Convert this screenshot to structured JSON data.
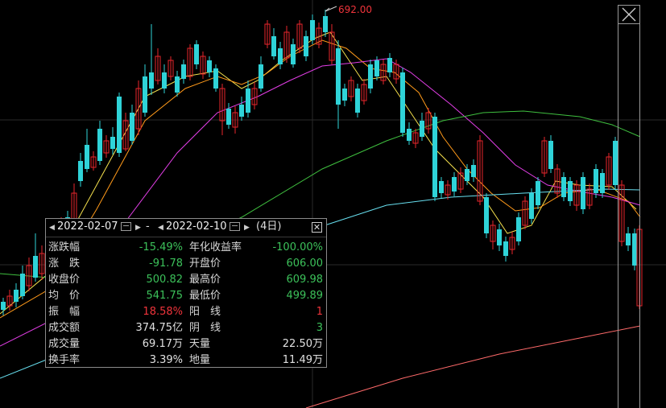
{
  "chart": {
    "high_marker": "692.00",
    "colors": {
      "up": "#e8262c",
      "down": "#2fd3d8",
      "ma5": "#ffffff",
      "ma10": "#f4e04d",
      "ma20": "#ff9a1a",
      "ma30": "#e23ee6",
      "ma60": "#3fbf3f",
      "ma120": "#68e0f0",
      "ma250": "#ff6a6a"
    }
  },
  "range_panel": {
    "start_date": "2022-02-07",
    "separator": "-",
    "end_date": "2022-02-10",
    "days": "(4日)",
    "rows": [
      {
        "label": "涨跌幅",
        "value": "-15.49%",
        "value_color": "g",
        "label2": "年化收益率",
        "value2": "-100.00%",
        "value2_color": "g"
      },
      {
        "label": "涨　跌",
        "value": "-91.78",
        "value_color": "g",
        "label2": "开盘价",
        "value2": "606.00",
        "value2_color": "g"
      },
      {
        "label": "收盘价",
        "value": "500.82",
        "value_color": "g",
        "label2": "最高价",
        "value2": "609.98",
        "value2_color": "g"
      },
      {
        "label": "均　价",
        "value": "541.75",
        "value_color": "g",
        "label2": "最低价",
        "value2": "499.89",
        "value2_color": "g"
      },
      {
        "label": "振　幅",
        "value": "18.58%",
        "value_color": "r",
        "label2": "阳　线",
        "value2": "1",
        "value2_color": "r"
      },
      {
        "label": "成交额",
        "value": "374.75亿",
        "value_color": "w",
        "label2": "阴　线",
        "value2": "3",
        "value2_color": "g"
      },
      {
        "label": "成交量",
        "value": "69.17万",
        "value_color": "w",
        "label2": "天量",
        "value2": "22.50万",
        "value2_color": "w"
      },
      {
        "label": "换手率",
        "value": "3.39%",
        "value_color": "w",
        "label2": "地量",
        "value2": "11.49万",
        "value2_color": "w"
      }
    ]
  }
}
